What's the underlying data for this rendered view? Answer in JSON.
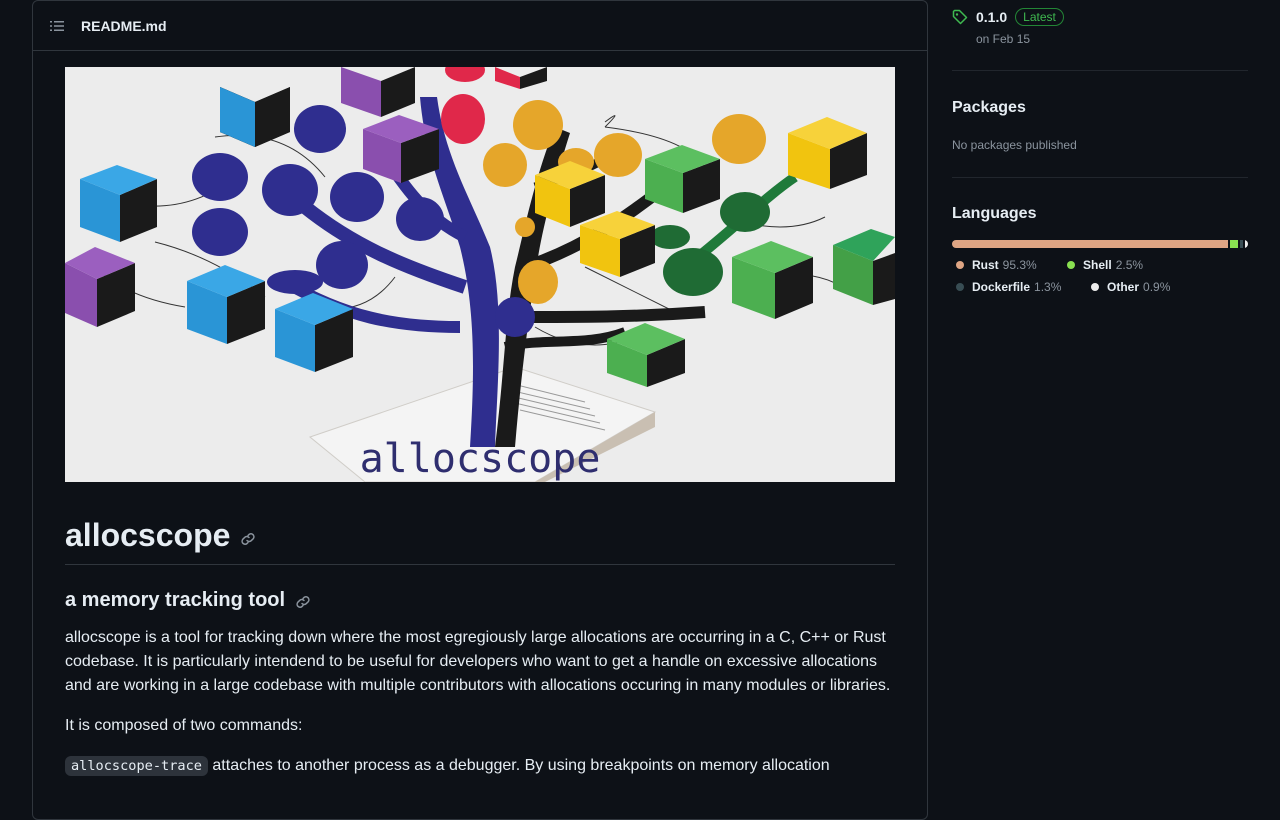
{
  "readme": {
    "filename": "README.md",
    "hero_logo_text": "allocscope",
    "title": "allocscope",
    "subtitle": "a memory tracking tool",
    "intro": "allocscope is a tool for tracking down where the most egregiously large allocations are occurring in a C, C++ or Rust codebase. It is particularly intendend to be useful for developers who want to get a handle on excessive allocations and are working in a large codebase with multiple contributors with allocations occuring in many modules or libraries.",
    "composed": "It is composed of two commands:",
    "cmd_trace_code": "allocscope-trace",
    "cmd_trace_text": " attaches to another process as a debugger. By using breakpoints on memory allocation"
  },
  "sidebar": {
    "release": {
      "version": "0.1.0",
      "badge": "Latest",
      "date": "on Feb 15"
    },
    "packages": {
      "title": "Packages",
      "empty": "No packages published"
    },
    "languages": {
      "title": "Languages",
      "items": [
        {
          "name": "Rust",
          "percent": "95.3%",
          "value": 95.3,
          "color": "#dea584"
        },
        {
          "name": "Shell",
          "percent": "2.5%",
          "value": 2.5,
          "color": "#89e051"
        },
        {
          "name": "Dockerfile",
          "percent": "1.3%",
          "value": 1.3,
          "color": "#384d54"
        },
        {
          "name": "Other",
          "percent": "0.9%",
          "value": 0.9,
          "color": "#ededed"
        }
      ]
    }
  },
  "colors": {
    "background": "#0d1117",
    "border": "#30363d",
    "text": "#e6edf3",
    "muted": "#8b949e",
    "accent_green": "#3fb950"
  },
  "icons": {
    "toc": "list-unordered-icon",
    "anchor": "link-icon",
    "tag": "tag-icon"
  }
}
